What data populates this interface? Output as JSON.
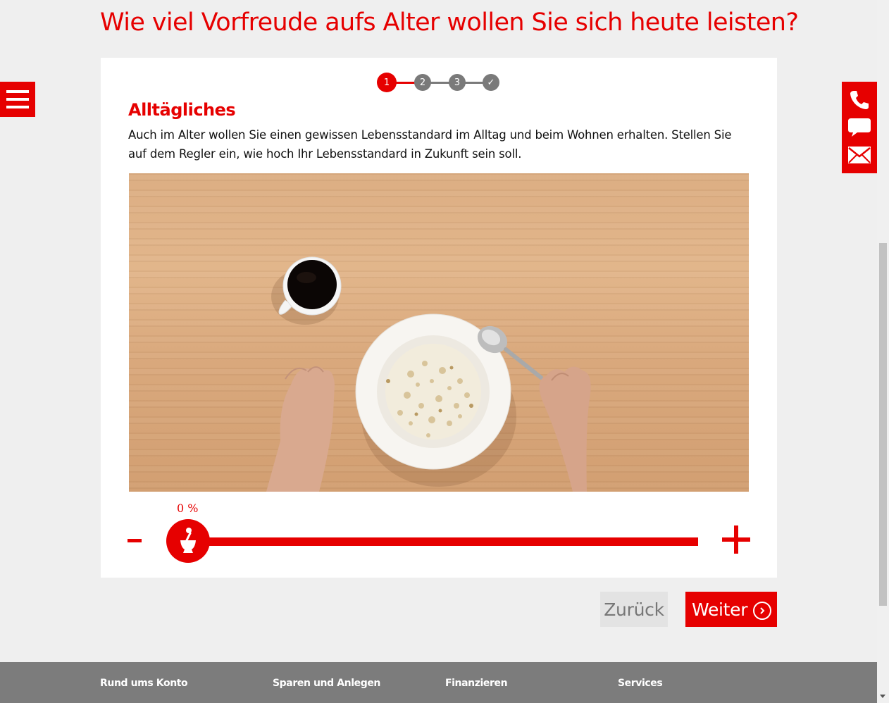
{
  "page": {
    "title": "Wie viel Vorfreude aufs Alter wollen Sie sich heute leisten?"
  },
  "stepper": {
    "steps": [
      "1",
      "2",
      "3",
      "✓"
    ],
    "current_step": 1
  },
  "section": {
    "title": "Alltägliches",
    "text": "Auch im Alter wollen Sie einen gewissen Lebensstandard im Alltag und beim Wohnen erhalten. Stellen Sie auf dem Regler ein, wie hoch Ihr Lebensstandard in Zukunft sein soll."
  },
  "slider": {
    "value_label": "0 %",
    "value_percent": 0,
    "minus_label": "-",
    "plus_label": "+"
  },
  "buttons": {
    "back_label": "Zurück",
    "next_label": "Weiter"
  },
  "footer": {
    "columns": [
      "Rund ums Konto",
      "Sparen und Anlegen",
      "Finanzieren",
      "Services"
    ]
  },
  "colors": {
    "brand_red": "#e60000",
    "footer_gray": "#7c7c7c",
    "step_gray": "#7a7a7a"
  },
  "icons": {
    "menu": "hamburger-menu-icon",
    "phone": "phone-icon",
    "chat": "chat-bubble-icon",
    "mail": "mail-icon",
    "slider_thumb": "mortar-pestle-icon",
    "next": "chevron-right-circle-icon"
  }
}
